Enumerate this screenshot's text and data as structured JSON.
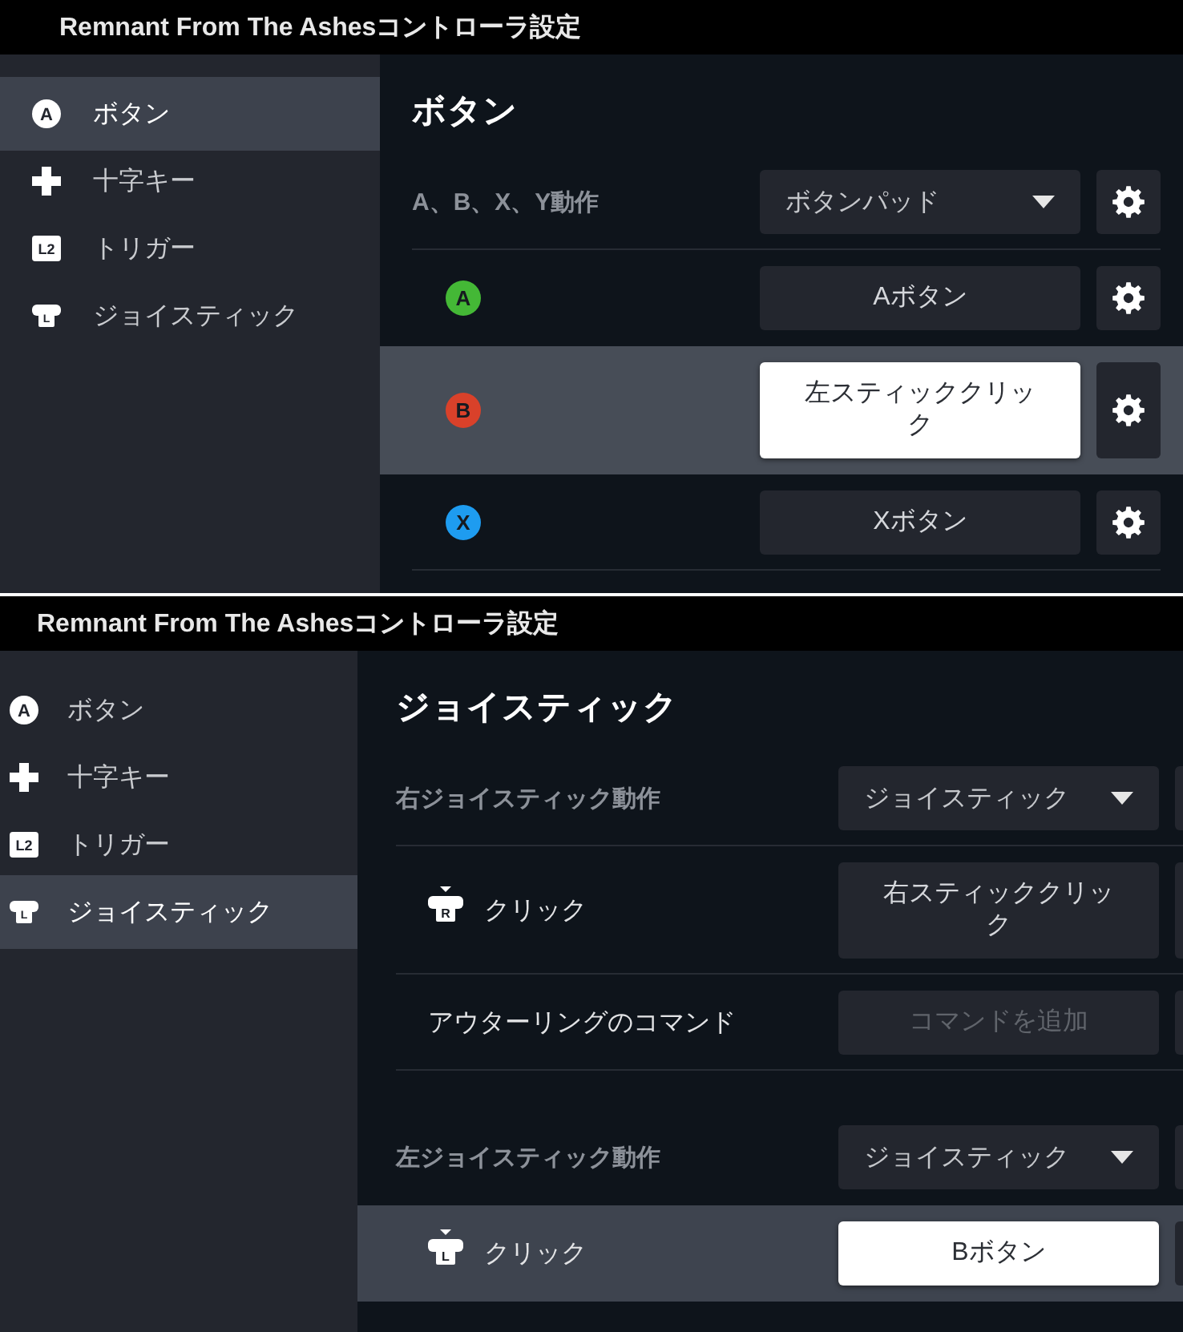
{
  "panels": [
    {
      "title": "Remnant From The Ashesコントローラ設定",
      "sidebar": {
        "items": [
          {
            "kind": "face-button",
            "glyph": "A",
            "label": "ボタン",
            "selected": true
          },
          {
            "kind": "dpad",
            "label": "十字キー",
            "selected": false
          },
          {
            "kind": "trigger",
            "glyph": "L2",
            "label": "トリガー",
            "selected": false
          },
          {
            "kind": "joystick",
            "glyph": "L",
            "label": "ジョイスティック",
            "selected": false
          }
        ]
      },
      "heading": "ボタン",
      "sections": [
        {
          "rows": [
            {
              "kind": "mode",
              "label": "A、B、X、Y動作",
              "value": "ボタンパッド",
              "selected": false
            },
            {
              "kind": "binding",
              "icon": {
                "kind": "face-button",
                "glyph": "A",
                "color": "#44b836"
              },
              "command": "Aボタン",
              "disabled": false,
              "selected": false
            },
            {
              "kind": "binding",
              "icon": {
                "kind": "face-button",
                "glyph": "B",
                "color": "#d9412a"
              },
              "command": "左スティッククリック",
              "disabled": false,
              "selected": true
            },
            {
              "kind": "binding",
              "icon": {
                "kind": "face-button",
                "glyph": "X",
                "color": "#1e9cf0"
              },
              "command": "Xボタン",
              "disabled": false,
              "selected": false
            }
          ]
        }
      ]
    },
    {
      "title": "Remnant From The Ashesコントローラ設定",
      "sidebar": {
        "items": [
          {
            "kind": "face-button",
            "glyph": "A",
            "label": "ボタン",
            "selected": false
          },
          {
            "kind": "dpad",
            "label": "十字キー",
            "selected": false
          },
          {
            "kind": "trigger",
            "glyph": "L2",
            "label": "トリガー",
            "selected": false
          },
          {
            "kind": "joystick",
            "glyph": "L",
            "label": "ジョイスティック",
            "selected": true
          }
        ]
      },
      "heading": "ジョイスティック",
      "sections": [
        {
          "rows": [
            {
              "kind": "mode",
              "label": "右ジョイスティック動作",
              "value": "ジョイスティック",
              "selected": false
            },
            {
              "kind": "binding",
              "icon": {
                "kind": "stick-click",
                "glyph": "R"
              },
              "label": "クリック",
              "command": "右スティッククリック",
              "disabled": false,
              "selected": false
            },
            {
              "kind": "binding",
              "label": "アウターリングのコマンド",
              "command": "コマンドを追加",
              "disabled": true,
              "selected": false
            }
          ]
        },
        {
          "rows": [
            {
              "kind": "mode",
              "label": "左ジョイスティック動作",
              "value": "ジョイスティック",
              "selected": false
            },
            {
              "kind": "binding",
              "icon": {
                "kind": "stick-click",
                "glyph": "L"
              },
              "label": "クリック",
              "command": "Bボタン",
              "disabled": false,
              "selected": true
            }
          ]
        }
      ]
    }
  ]
}
